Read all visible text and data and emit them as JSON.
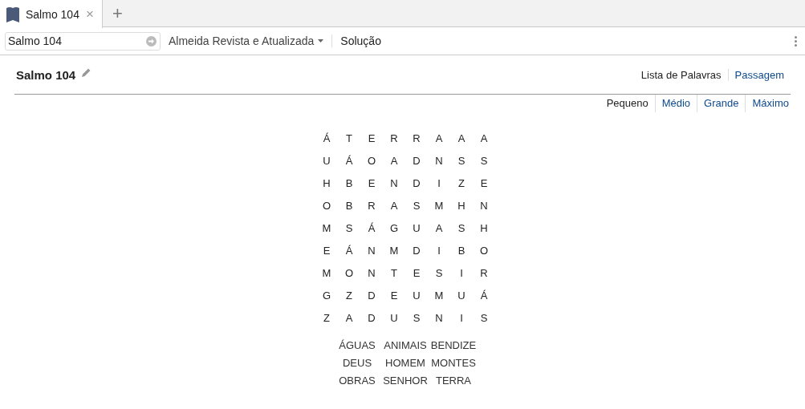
{
  "tabs": [
    {
      "label": "Salmo 104",
      "selected": true,
      "close": "×"
    }
  ],
  "new_tab": "+",
  "toolbar": {
    "search_value": "Salmo 104",
    "version": "Almeida Revista e Atualizada",
    "solution": "Solução"
  },
  "title": "Salmo 104",
  "views": [
    {
      "label": "Lista de Palavras",
      "selected": true
    },
    {
      "label": "Passagem",
      "selected": false
    }
  ],
  "sizes": [
    {
      "label": "Pequeno",
      "selected": true
    },
    {
      "label": "Médio",
      "selected": false
    },
    {
      "label": "Grande",
      "selected": false
    },
    {
      "label": "Máximo",
      "selected": false
    }
  ],
  "grid": [
    [
      "Á",
      "T",
      "E",
      "R",
      "R",
      "A",
      "A",
      "A"
    ],
    [
      "U",
      "Á",
      "O",
      "A",
      "D",
      "N",
      "S",
      "S"
    ],
    [
      "H",
      "B",
      "E",
      "N",
      "D",
      "I",
      "Z",
      "E"
    ],
    [
      "O",
      "B",
      "R",
      "A",
      "S",
      "M",
      "H",
      "N"
    ],
    [
      "M",
      "S",
      "Á",
      "G",
      "U",
      "A",
      "S",
      "H"
    ],
    [
      "E",
      "Á",
      "N",
      "M",
      "D",
      "I",
      "B",
      "O"
    ],
    [
      "M",
      "O",
      "N",
      "T",
      "E",
      "S",
      "I",
      "R"
    ],
    [
      "G",
      "Z",
      "D",
      "E",
      "U",
      "M",
      "U",
      "Á"
    ],
    [
      "Z",
      "A",
      "D",
      "U",
      "S",
      "N",
      "I",
      "S"
    ]
  ],
  "words": [
    "ÁGUAS",
    "ANIMAIS",
    "BENDIZE",
    "DEUS",
    "HOMEM",
    "MONTES",
    "OBRAS",
    "SENHOR",
    "TERRA"
  ]
}
